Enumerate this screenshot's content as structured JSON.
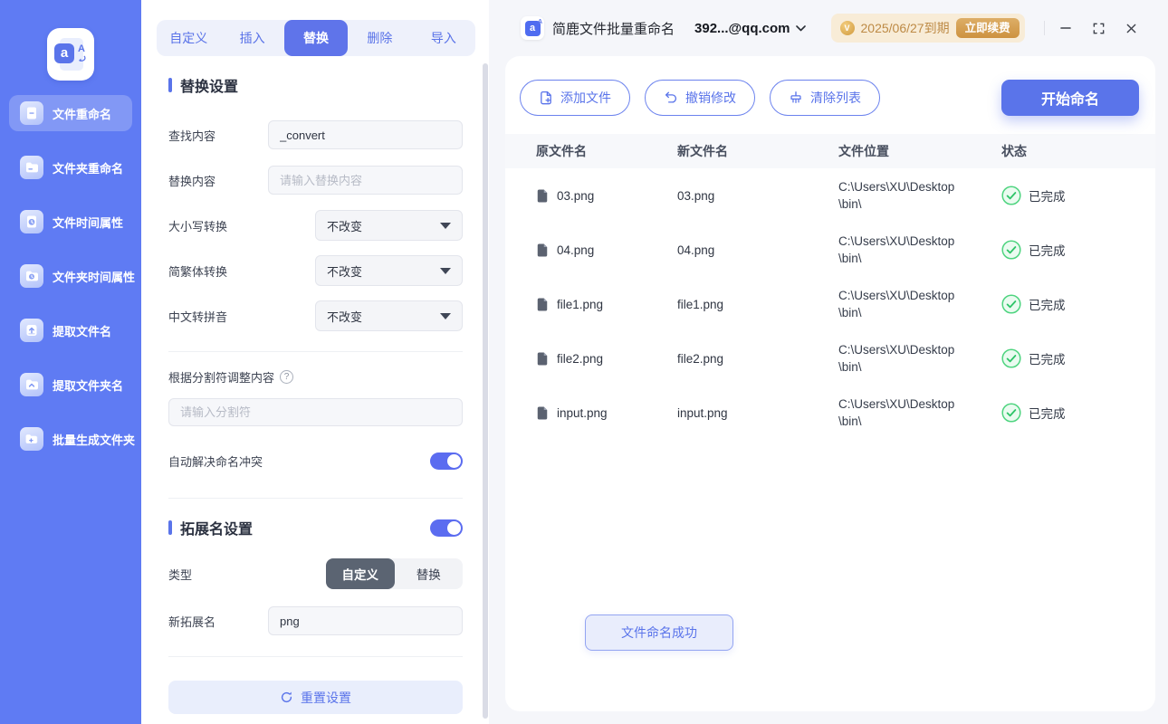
{
  "colors": {
    "accent": "#5a74ea",
    "sidebar": "#5f7bf3",
    "gold_badge_bg": "#f8ecd7",
    "gold_text": "#bd8a45",
    "success_green": "#3ecb72",
    "toggle_on": "#5b6cf0"
  },
  "icons": {
    "help": "?",
    "logo_letter": "a",
    "logo_letter_secondary": "A",
    "medal_letter": "V"
  },
  "sidebar": {
    "items": [
      {
        "label": "文件重命名",
        "active": true
      },
      {
        "label": "文件夹重命名",
        "active": false
      },
      {
        "label": "文件时间属性",
        "active": false
      },
      {
        "label": "文件夹时间属性",
        "active": false
      },
      {
        "label": "提取文件名",
        "active": false
      },
      {
        "label": "提取文件夹名",
        "active": false
      },
      {
        "label": "批量生成文件夹",
        "active": false
      }
    ]
  },
  "tabs": {
    "items": [
      {
        "label": "自定义",
        "active": false
      },
      {
        "label": "插入",
        "active": false
      },
      {
        "label": "替换",
        "active": true
      },
      {
        "label": "删除",
        "active": false
      },
      {
        "label": "导入",
        "active": false
      }
    ]
  },
  "settings": {
    "section_title": "替换设置",
    "find_label": "查找内容",
    "find_value": "_convert",
    "replace_label": "替换内容",
    "replace_placeholder": "请输入替换内容",
    "case_label": "大小写转换",
    "case_value": "不改变",
    "traditional_label": "简繁体转换",
    "traditional_value": "不改变",
    "pinyin_label": "中文转拼音",
    "pinyin_value": "不改变",
    "splitter_label": "根据分割符调整内容",
    "splitter_placeholder": "请输入分割符",
    "conflict_label": "自动解决命名冲突",
    "conflict_on": true,
    "ext_section_title": "拓展名设置",
    "ext_on": true,
    "type_label": "类型",
    "type_options": [
      {
        "label": "自定义",
        "active": true
      },
      {
        "label": "替换",
        "active": false
      }
    ],
    "new_ext_label": "新拓展名",
    "new_ext_value": "png",
    "reset_label": "重置设置"
  },
  "titlebar": {
    "app_title": "简鹿文件批量重命名",
    "account": "392...@qq.com",
    "license_expiry": "2025/06/27到期",
    "renew_label": "立即续费"
  },
  "toolbar": {
    "add_files": "添加文件",
    "undo": "撤销修改",
    "clear_list": "清除列表",
    "start": "开始命名"
  },
  "file_table": {
    "headers": [
      "原文件名",
      "新文件名",
      "文件位置",
      "状态"
    ],
    "rows": [
      {
        "original": "03.png",
        "new": "03.png",
        "path_line1": "C:\\Users\\XU\\Desktop",
        "path_line2": "\\bin\\",
        "status": "已完成"
      },
      {
        "original": "04.png",
        "new": "04.png",
        "path_line1": "C:\\Users\\XU\\Desktop",
        "path_line2": "\\bin\\",
        "status": "已完成"
      },
      {
        "original": "file1.png",
        "new": "file1.png",
        "path_line1": "C:\\Users\\XU\\Desktop",
        "path_line2": "\\bin\\",
        "status": "已完成"
      },
      {
        "original": "file2.png",
        "new": "file2.png",
        "path_line1": "C:\\Users\\XU\\Desktop",
        "path_line2": "\\bin\\",
        "status": "已完成"
      },
      {
        "original": "input.png",
        "new": "input.png",
        "path_line1": "C:\\Users\\XU\\Desktop",
        "path_line2": "\\bin\\",
        "status": "已完成"
      }
    ]
  },
  "toast": {
    "message": "文件命名成功"
  }
}
